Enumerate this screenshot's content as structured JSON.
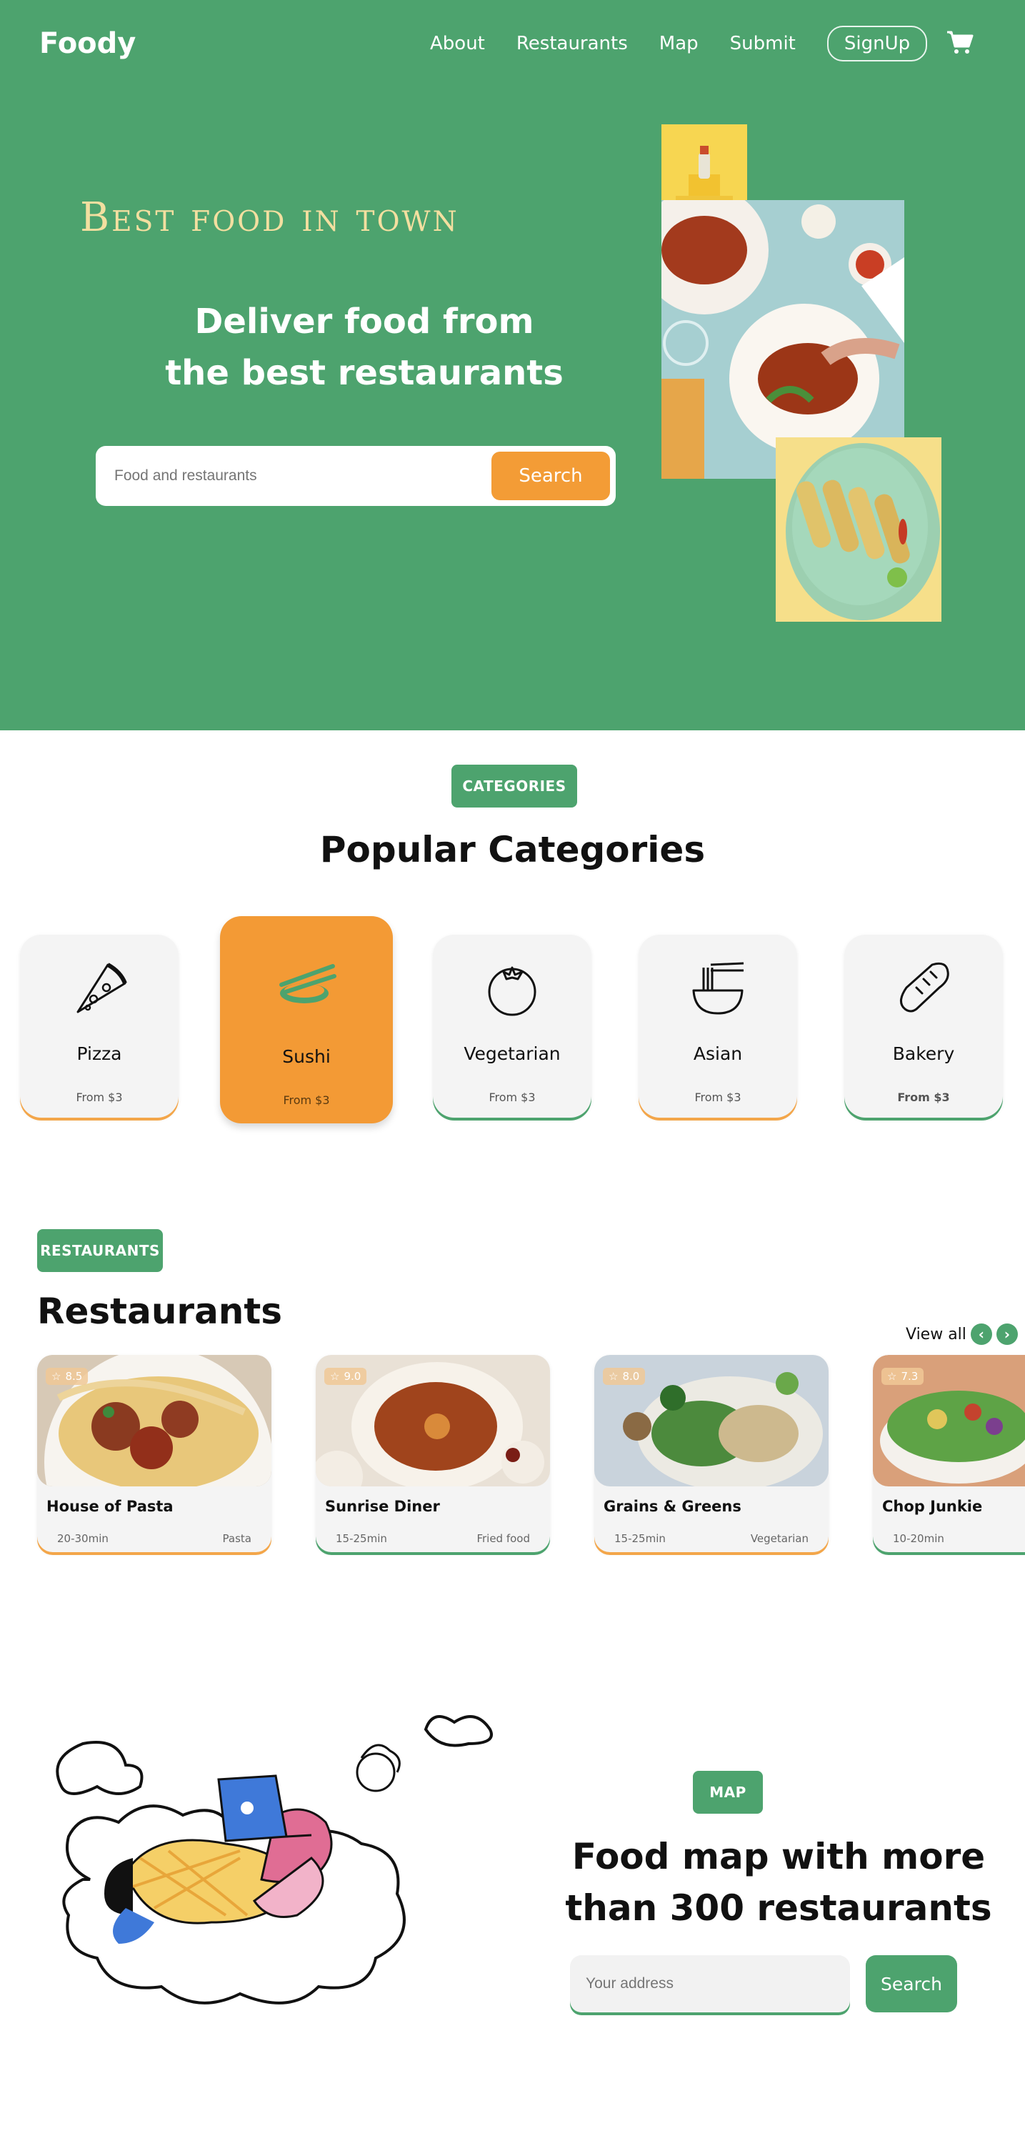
{
  "header": {
    "logo": "Foody",
    "nav": [
      "About",
      "Restaurants",
      "Map",
      "Submit"
    ],
    "signup_label": "SignUp",
    "cart_icon": "cart-icon"
  },
  "hero": {
    "tagline": "Best food in town",
    "headline_line1": "Deliver food from",
    "headline_line2": "the best restaurants",
    "search_placeholder": "Food and restaurants",
    "search_button": "Search"
  },
  "categories": {
    "badge": "CATEGORIES",
    "title": "Popular Categories",
    "items": [
      {
        "name": "Pizza",
        "price": "From $3",
        "icon": "pizza-icon"
      },
      {
        "name": "Sushi",
        "price": "From $3",
        "icon": "sushi-icon",
        "active": true
      },
      {
        "name": "Vegetarian",
        "price": "From $3",
        "icon": "tomato-icon"
      },
      {
        "name": "Asian",
        "price": "From $3",
        "icon": "noodles-icon"
      },
      {
        "name": "Bakery",
        "price": "From $3",
        "icon": "bread-icon"
      }
    ]
  },
  "restaurants": {
    "badge": "RESTAURANTS",
    "title": "Restaurants",
    "view_all": "View all",
    "items": [
      {
        "rating": "8.5",
        "name": "House of Pasta",
        "time": "20-30min",
        "type": "Pasta"
      },
      {
        "rating": "9.0",
        "name": "Sunrise Diner",
        "time": "15-25min",
        "type": "Fried food"
      },
      {
        "rating": "8.0",
        "name": "Grains & Greens",
        "time": "15-25min",
        "type": "Vegetarian"
      },
      {
        "rating": "7.3",
        "name": "Chop Junkie",
        "time": "10-20min",
        "type": ""
      }
    ]
  },
  "map": {
    "badge": "MAP",
    "title_line1": "Food map with more",
    "title_line2": "than 300 restaurants",
    "address_placeholder": "Your address",
    "search_button": "Search"
  },
  "colors": {
    "brand_green": "#4da36e",
    "accent_orange": "#f39c36",
    "tagline_cream": "#f3dfa0"
  }
}
